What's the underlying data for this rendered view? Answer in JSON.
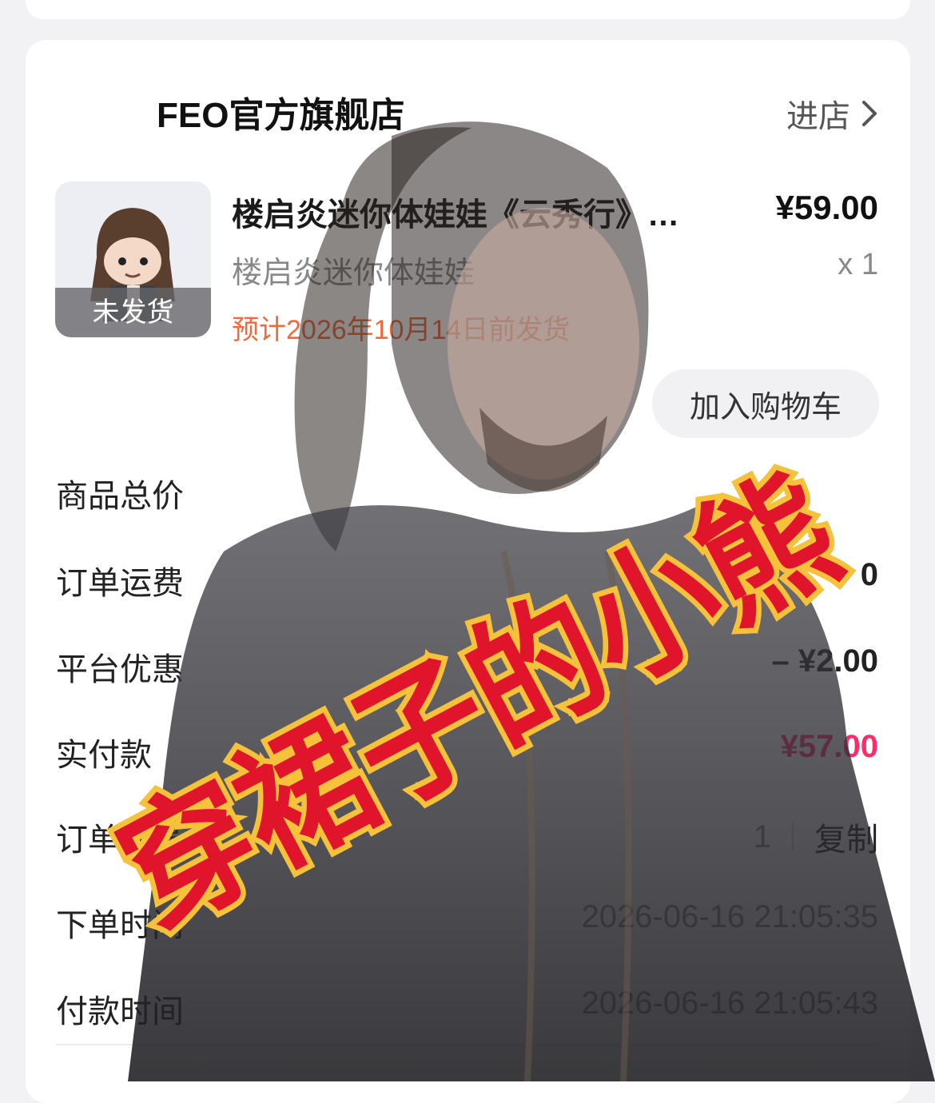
{
  "store": {
    "name": "FEO官方旗舰店",
    "enter_label": "进店"
  },
  "product": {
    "thumbnail_badge": "未发货",
    "title": "楼启炎迷你体娃娃《云秀行》…",
    "price": "¥59.00",
    "spec": "楼启炎迷你体娃娃",
    "quantity": "x 1",
    "ship_estimate": "预计2026年10月14日前发货",
    "add_to_cart_label": "加入购物车"
  },
  "summary": {
    "goods_total_label": "商品总价",
    "shipping_label": "订单运费",
    "shipping_value": "0",
    "platform_discount_label": "平台优惠",
    "platform_discount_value": "– ¥2.00",
    "paid_label": "实付款",
    "paid_value": "¥57.00",
    "order_no_label": "订单编号",
    "order_no_value": "1",
    "copy_label": "复制",
    "order_time_label": "下单时间",
    "order_time_value": "2026-06-16 21:05:35",
    "pay_time_label": "付款时间",
    "pay_time_value": "2026-06-16 21:05:43"
  },
  "overlay": {
    "watermark_text": "穿裙子的小熊"
  },
  "colors": {
    "pay_accent": "#ff2b6b",
    "ship_estimate": "#f06a3c",
    "watermark_red": "#e0142a"
  },
  "icons": {
    "store_chevron": "chevron-right-icon"
  }
}
